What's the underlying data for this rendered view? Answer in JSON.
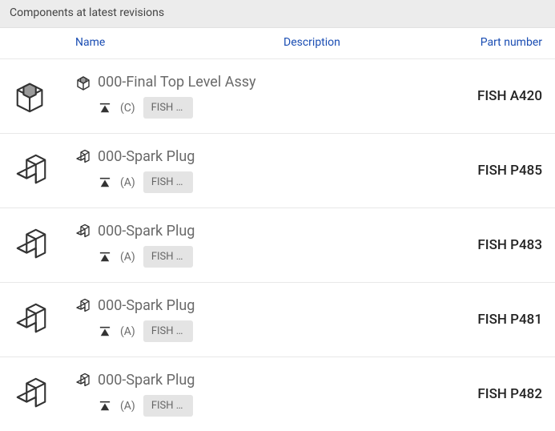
{
  "header": {
    "title": "Components at latest revisions"
  },
  "columns": {
    "name": "Name",
    "description": "Description",
    "part_number": "Part number"
  },
  "rows": [
    {
      "type": "assembly",
      "name": "000-Final Top Level Assy",
      "rev": "(C)",
      "chip": "FISH A…",
      "part_number": "FISH A420"
    },
    {
      "type": "part",
      "name": "000-Spark Plug",
      "rev": "(A)",
      "chip": "FISH P…",
      "part_number": "FISH P485"
    },
    {
      "type": "part",
      "name": "000-Spark Plug",
      "rev": "(A)",
      "chip": "FISH P…",
      "part_number": "FISH P483"
    },
    {
      "type": "part",
      "name": "000-Spark Plug",
      "rev": "(A)",
      "chip": "FISH P…",
      "part_number": "FISH P481"
    },
    {
      "type": "part",
      "name": "000-Spark Plug",
      "rev": "(A)",
      "chip": "FISH P…",
      "part_number": "FISH P482"
    }
  ]
}
